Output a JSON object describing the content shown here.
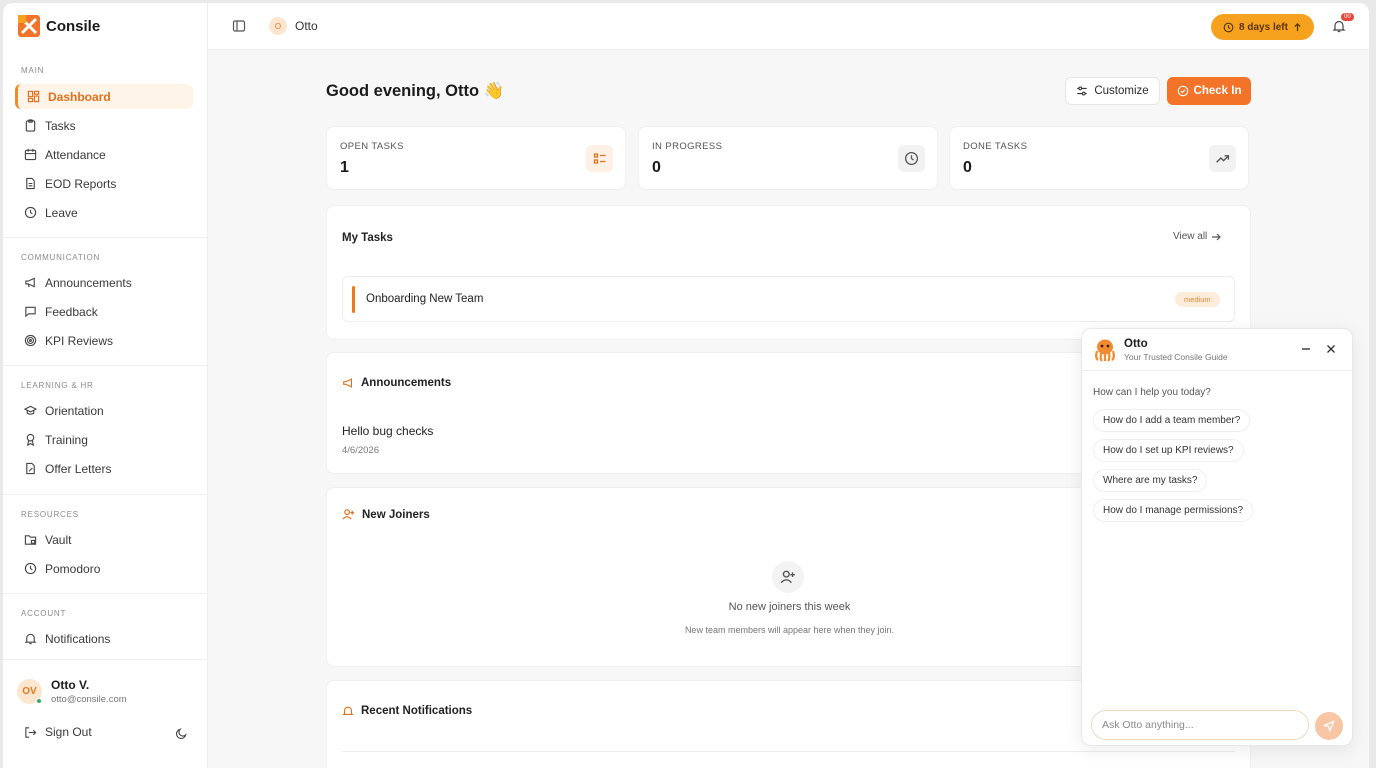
{
  "app": {
    "name": "Consile"
  },
  "sidebar": {
    "sections": {
      "main": "MAIN",
      "communication": "COMMUNICATION",
      "learning": "LEARNING & HR",
      "resources": "RESOURCES",
      "account": "ACCOUNT"
    },
    "items": {
      "dashboard": "Dashboard",
      "tasks": "Tasks",
      "attendance": "Attendance",
      "eod": "EOD Reports",
      "leave": "Leave",
      "announcements": "Announcements",
      "feedback": "Feedback",
      "kpi": "KPI Reviews",
      "orientation": "Orientation",
      "training": "Training",
      "offer": "Offer Letters",
      "vault": "Vault",
      "pomodoro": "Pomodoro",
      "notifications": "Notifications"
    },
    "user": {
      "initials": "OV",
      "name": "Otto V.",
      "email": "otto@consile.com"
    },
    "signout": "Sign Out"
  },
  "topbar": {
    "avatar_initial": "O",
    "name": "Otto",
    "trial": "8 days left",
    "badge": "00"
  },
  "main": {
    "greeting": "Good evening, Otto 👋",
    "customize": "Customize",
    "checkin": "Check In",
    "stats": [
      {
        "label": "OPEN TASKS",
        "value": "1"
      },
      {
        "label": "IN PROGRESS",
        "value": "0"
      },
      {
        "label": "DONE TASKS",
        "value": "0"
      }
    ],
    "my_tasks": {
      "title": "My Tasks",
      "view_all": "View all",
      "task": "Onboarding New Team",
      "priority": "medium"
    },
    "announcements": {
      "title": "Announcements",
      "text": "Hello bug checks",
      "date": "4/6/2026"
    },
    "new_joiners": {
      "title": "New Joiners",
      "empty_title": "No new joiners this week",
      "empty_sub": "New team members will appear here when they join."
    },
    "recent": {
      "title": "Recent Notifications"
    }
  },
  "chat": {
    "name": "Otto",
    "subtitle": "Your Trusted Consile Guide",
    "prompt": "How can I help you today?",
    "suggestions": [
      "How do I add a team member?",
      "How do I set up KPI reviews?",
      "Where are my tasks?",
      "How do I manage permissions?"
    ],
    "placeholder": "Ask Otto anything..."
  },
  "colors": {
    "accent": "#f37328",
    "trial": "#f6a21e",
    "active_bg": "#fff4e8"
  }
}
